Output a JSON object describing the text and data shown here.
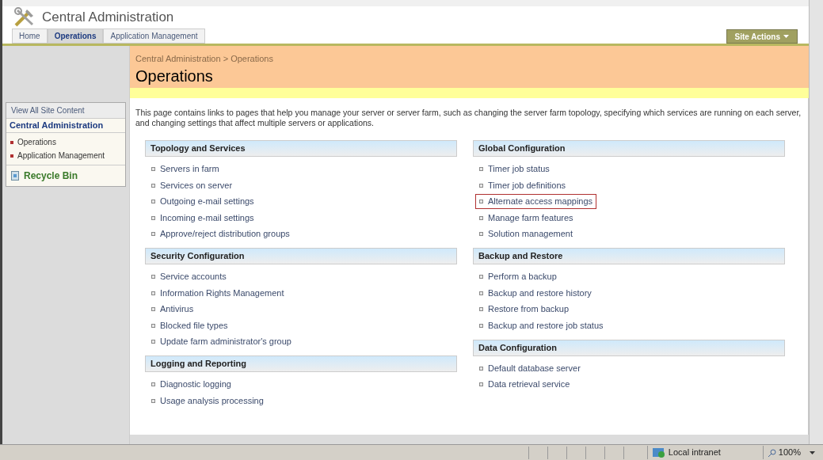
{
  "header": {
    "title": "Central Administration"
  },
  "tabs": [
    {
      "label": "Home",
      "selected": false
    },
    {
      "label": "Operations",
      "selected": true
    },
    {
      "label": "Application Management",
      "selected": false
    }
  ],
  "site_actions": {
    "label": "Site Actions"
  },
  "sidebar": {
    "view_all": "View All Site Content",
    "heading": "Central Administration",
    "items": [
      {
        "label": "Operations"
      },
      {
        "label": "Application Management"
      }
    ],
    "recycle_bin": "Recycle Bin"
  },
  "breadcrumb": "Central Administration > Operations",
  "page_title": "Operations",
  "description": "This page contains links to pages that help you manage your server or server farm, such as changing the server farm topology, specifying which services are running on each server, and changing settings that affect multiple servers or applications.",
  "columns": [
    {
      "sections": [
        {
          "title": "Topology and Services",
          "links": [
            {
              "label": "Servers in farm",
              "highlighted": false
            },
            {
              "label": "Services on server",
              "highlighted": false
            },
            {
              "label": "Outgoing e-mail settings",
              "highlighted": false
            },
            {
              "label": "Incoming e-mail settings",
              "highlighted": false
            },
            {
              "label": "Approve/reject distribution groups",
              "highlighted": false
            }
          ]
        },
        {
          "title": "Security Configuration",
          "links": [
            {
              "label": "Service accounts",
              "highlighted": false
            },
            {
              "label": "Information Rights Management",
              "highlighted": false
            },
            {
              "label": "Antivirus",
              "highlighted": false
            },
            {
              "label": "Blocked file types",
              "highlighted": false
            },
            {
              "label": "Update farm administrator's group",
              "highlighted": false
            }
          ]
        },
        {
          "title": "Logging and Reporting",
          "links": [
            {
              "label": "Diagnostic logging",
              "highlighted": false
            },
            {
              "label": "Usage analysis processing",
              "highlighted": false
            }
          ]
        }
      ]
    },
    {
      "sections": [
        {
          "title": "Global Configuration",
          "links": [
            {
              "label": "Timer job status",
              "highlighted": false
            },
            {
              "label": "Timer job definitions",
              "highlighted": false
            },
            {
              "label": "Alternate access mappings",
              "highlighted": true
            },
            {
              "label": "Manage farm features",
              "highlighted": false
            },
            {
              "label": "Solution management",
              "highlighted": false
            }
          ]
        },
        {
          "title": "Backup and Restore",
          "links": [
            {
              "label": "Perform a backup",
              "highlighted": false
            },
            {
              "label": "Backup and restore history",
              "highlighted": false
            },
            {
              "label": "Restore from backup",
              "highlighted": false
            },
            {
              "label": "Backup and restore job status",
              "highlighted": false
            }
          ]
        },
        {
          "title": "Data Configuration",
          "links": [
            {
              "label": "Default database server",
              "highlighted": false
            },
            {
              "label": "Data retrieval service",
              "highlighted": false
            }
          ]
        }
      ]
    }
  ],
  "status_bar": {
    "zone": "Local intranet",
    "zoom": "100%"
  }
}
